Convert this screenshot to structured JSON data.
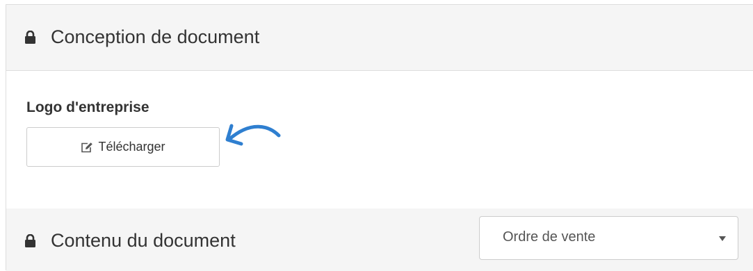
{
  "design_section": {
    "icon": "lock-icon",
    "title": "Conception de document"
  },
  "logo_field": {
    "label": "Logo d'entreprise",
    "button_icon": "edit-icon",
    "button_label": "Télécharger"
  },
  "annotation": {
    "icon": "curved-arrow-icon",
    "color": "#2f7fd0"
  },
  "content_section": {
    "icon": "lock-icon",
    "title": "Contenu du document",
    "select_value": "Ordre de vente"
  }
}
